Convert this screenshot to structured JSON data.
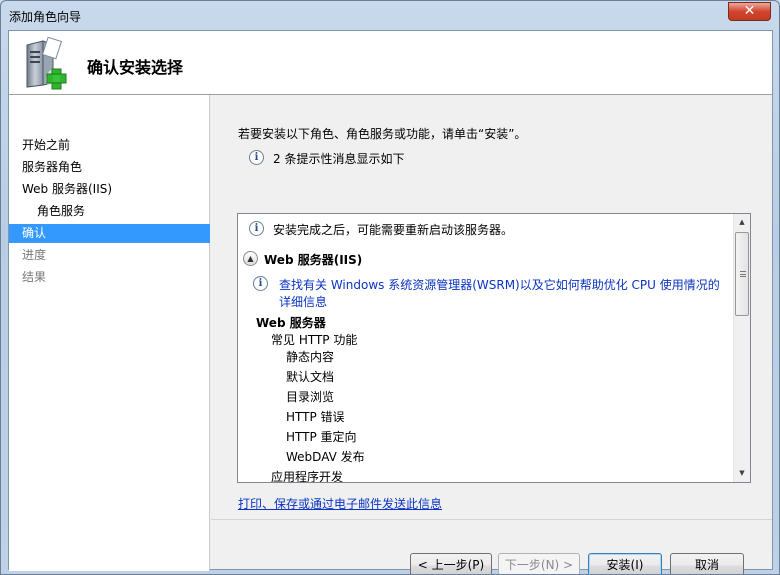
{
  "window": {
    "title": "添加角色向导",
    "close_glyph": "✕"
  },
  "header": {
    "title": "确认安装选择",
    "icon": "server-add-icon"
  },
  "sidebar": {
    "items": [
      {
        "label": "开始之前",
        "state": "normal"
      },
      {
        "label": "服务器角色",
        "state": "normal"
      },
      {
        "label": "Web 服务器(IIS)",
        "state": "normal"
      },
      {
        "label": "角色服务",
        "state": "sub"
      },
      {
        "label": "确认",
        "state": "active"
      },
      {
        "label": "进度",
        "state": "disabled"
      },
      {
        "label": "结果",
        "state": "disabled"
      }
    ]
  },
  "main": {
    "intro": "若要安装以下角色、角色服务或功能，请单击“安装”。",
    "hint": "2 条提示性消息显示如下",
    "list": {
      "restart_note": "安装完成之后，可能需要重新启动该服务器。",
      "role_heading": "Web 服务器(IIS)",
      "wsrm_link_line1": "查找有关 Windows 系统资源管理器(WSRM)以及它如何帮助优化 CPU 使用情况的",
      "wsrm_link_line2": "详细信息",
      "section": "Web 服务器",
      "subsection": "常见 HTTP 功能",
      "features": [
        "静态内容",
        "默认文档",
        "目录浏览",
        "HTTP 错误",
        "HTTP 重定向",
        "WebDAV 发布"
      ],
      "next_subsection": "应用程序开发"
    },
    "print_link": "打印、保存或通过电子邮件发送此信息"
  },
  "buttons": {
    "back": "< 上一步(P)",
    "next": "下一步(N) >",
    "install": "安装(I)",
    "cancel": "取消"
  },
  "colors": {
    "selection": "#3399ff",
    "link": "#0b33c2"
  }
}
